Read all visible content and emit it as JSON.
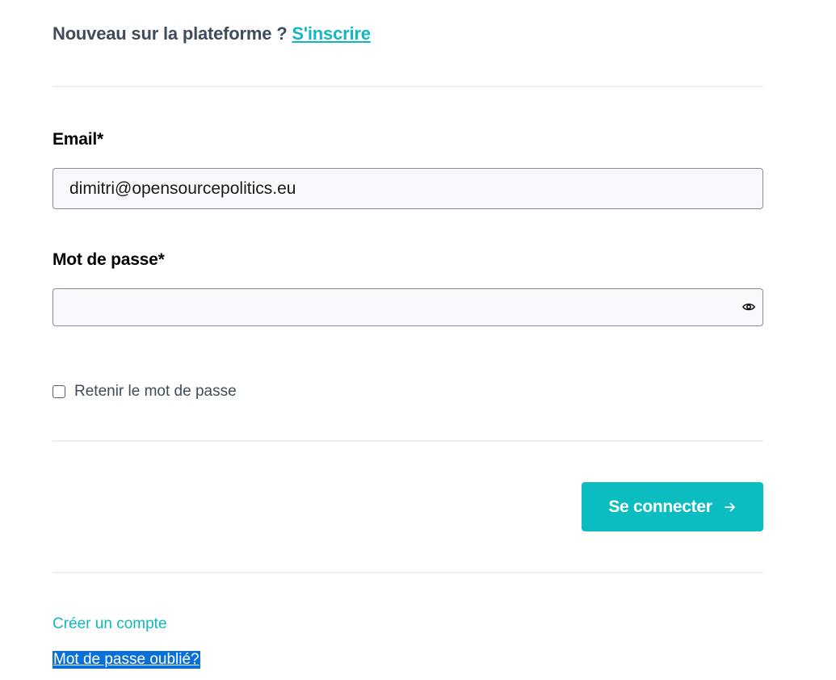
{
  "signup": {
    "prompt": "Nouveau sur la plateforme ?",
    "link_label": "S'inscrire"
  },
  "form": {
    "email": {
      "label": "Email*",
      "value": "dimitri@opensourcepolitics.eu",
      "placeholder": ""
    },
    "password": {
      "label": "Mot de passe*",
      "value": "",
      "placeholder": "",
      "toggle_icon": "eye-icon"
    },
    "remember": {
      "label": "Retenir le mot de passe",
      "checked": false
    },
    "submit": {
      "label": "Se connecter",
      "icon": "arrow-right-icon"
    }
  },
  "links": {
    "create_account": "Créer un compte",
    "forgot_password": "Mot de passe oublié?"
  },
  "colors": {
    "accent": "#0bbcc0",
    "text": "#3e4c5c",
    "selection": "#0a6fd6"
  }
}
